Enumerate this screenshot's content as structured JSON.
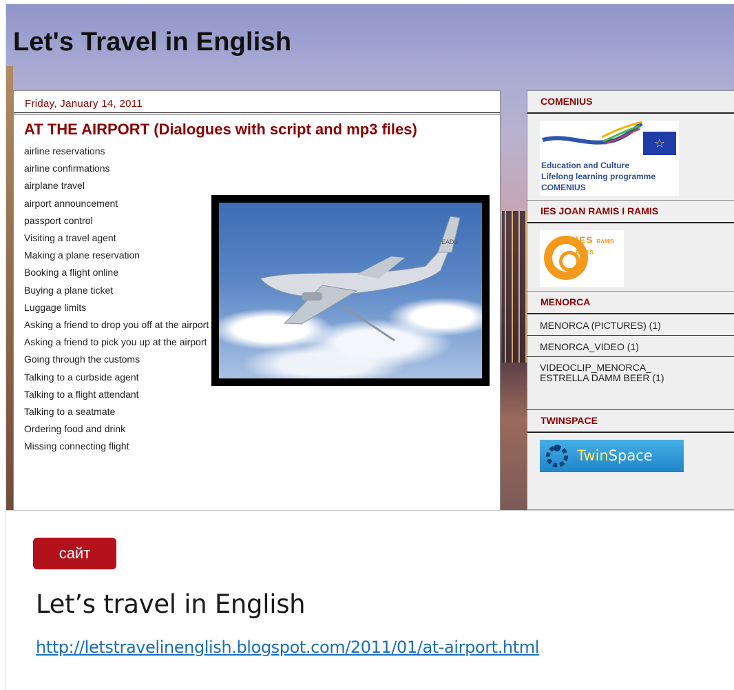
{
  "screenshot": {
    "blog_title": "Let's Travel in English",
    "post": {
      "date": "Friday, January 14, 2011",
      "title": "AT THE AIRPORT (Dialogues with script and mp3 files)",
      "topics": [
        "airline reservations",
        "airline confirmations",
        "airplane travel",
        "airport announcement",
        "passport control",
        "Visiting a travel agent",
        "Making a plane reservation",
        "Booking a flight online",
        "Buying a plane ticket",
        "Luggage limits",
        "Asking a friend to drop you off at the airport",
        "Asking a friend to pick you up at the airport",
        "Going through the customs",
        "Talking to a curbside agent",
        "Talking to a flight attendant",
        "Talking to a seatmate",
        "Ordering food and drink",
        "Missing connecting flight"
      ],
      "image_icon": "airplane-in-clouds-image",
      "image_text": "EADS"
    },
    "sidebar": {
      "comenius_heading": "COMENIUS",
      "comenius_logo_caption": "Education and Culture\nLifelong learning programme\nCOMENIUS",
      "ies_heading": "IES JOAN RAMIS I RAMIS",
      "ies_logo_text": "IES",
      "ies_logo_small": "RAMIS RAMIS",
      "menorca_heading": "MENORCA",
      "menorca_links": [
        "MENORCA (PICTURES) (1)",
        "MENORCA_VIDEO (1)",
        "VIDEOCLIP_MENORCA_\nESTRELLA DAMM BEER (1)"
      ],
      "twinspace_heading": "TWINSPACE",
      "twinspace_logo_a": "Twin",
      "twinspace_logo_b": "Space"
    }
  },
  "tag_label": "сайт",
  "page_title": "Let’s travel in English",
  "link_text": "http://letstravelinenglish.blogspot.com/2011/01/at-airport.html",
  "colors": {
    "tag_bg": "#b3121b",
    "post_accent": "#8b0000",
    "link": "#1a6fb8"
  }
}
